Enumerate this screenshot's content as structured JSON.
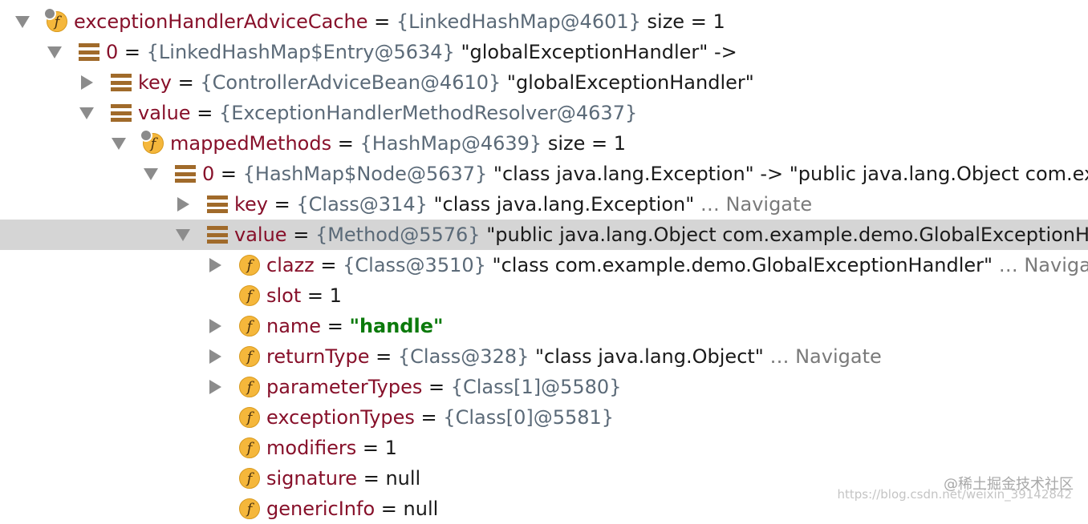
{
  "rows": [
    {
      "name": "exceptionHandlerAdviceCache",
      "eq": " = ",
      "ref": "{LinkedHashMap@4601}",
      "str": "  size = 1",
      "toggle": "expanded",
      "icon": "field-static"
    },
    {
      "name": "0",
      "eq": " = ",
      "ref": "{LinkedHashMap$Entry@5634}",
      "str": " \"globalExceptionHandler\" ->",
      "toggle": "expanded",
      "icon": "entry"
    },
    {
      "name": "key",
      "eq": " = ",
      "ref": "{ControllerAdviceBean@4610}",
      "str": " \"globalExceptionHandler\"",
      "toggle": "collapsed",
      "icon": "entry"
    },
    {
      "name": "value",
      "eq": " = ",
      "ref": "{ExceptionHandlerMethodResolver@4637}",
      "toggle": "expanded",
      "icon": "entry"
    },
    {
      "name": "mappedMethods",
      "eq": " = ",
      "ref": "{HashMap@4639}",
      "str": "  size = 1",
      "toggle": "expanded",
      "icon": "field-static"
    },
    {
      "name": "0",
      "eq": " = ",
      "ref": "{HashMap$Node@5637}",
      "str": " \"class java.lang.Exception\" -> \"public java.lang.Object com.example.demo.GlobalExceptionHandler.handle(java.lang.Exception)\"",
      "toggle": "expanded",
      "icon": "entry"
    },
    {
      "name": "key",
      "eq": " = ",
      "ref": "{Class@314}",
      "str": " \"class java.lang.Exception\"",
      "nav": " … Navigate",
      "toggle": "collapsed",
      "icon": "entry"
    },
    {
      "name": "value",
      "eq": " = ",
      "ref": "{Method@5576}",
      "str": " \"public java.lang.Object com.example.demo.GlobalExceptionHandler.handle(java.lang.Exception)\"",
      "toggle": "expanded",
      "icon": "entry",
      "selected": true
    },
    {
      "name": "clazz",
      "eq": " = ",
      "ref": "{Class@3510}",
      "str": " \"class com.example.demo.GlobalExceptionHandler\"",
      "nav": " … Navigate",
      "toggle": "collapsed",
      "icon": "field"
    },
    {
      "name": "slot",
      "eq": " = ",
      "str": "1",
      "toggle": "none",
      "icon": "field"
    },
    {
      "name": "name",
      "eq": " = ",
      "strval": "\"handle\"",
      "toggle": "collapsed",
      "icon": "field"
    },
    {
      "name": "returnType",
      "eq": " = ",
      "ref": "{Class@328}",
      "str": " \"class java.lang.Object\"",
      "nav": " … Navigate",
      "toggle": "collapsed",
      "icon": "field"
    },
    {
      "name": "parameterTypes",
      "eq": " = ",
      "ref": "{Class[1]@5580}",
      "toggle": "collapsed",
      "icon": "field"
    },
    {
      "name": "exceptionTypes",
      "eq": " = ",
      "ref": "{Class[0]@5581}",
      "toggle": "none",
      "icon": "field"
    },
    {
      "name": "modifiers",
      "eq": " = ",
      "str": "1",
      "toggle": "none",
      "icon": "field"
    },
    {
      "name": "signature",
      "eq": " = ",
      "str": "null",
      "toggle": "none",
      "icon": "field"
    },
    {
      "name": "genericInfo",
      "eq": " = ",
      "str": "null",
      "toggle": "none",
      "icon": "field"
    }
  ],
  "watermark": {
    "text": "@稀土掘金技术社区",
    "url_text": "https://blog.csdn.net/weixin_39142842"
  },
  "colors": {
    "name": "#87102a",
    "ref": "#5b6a78",
    "string": "#0b7a0b",
    "selection": "#d5d5d5",
    "field_icon": "#f5b73b",
    "entry_icon": "#a06a2a"
  }
}
